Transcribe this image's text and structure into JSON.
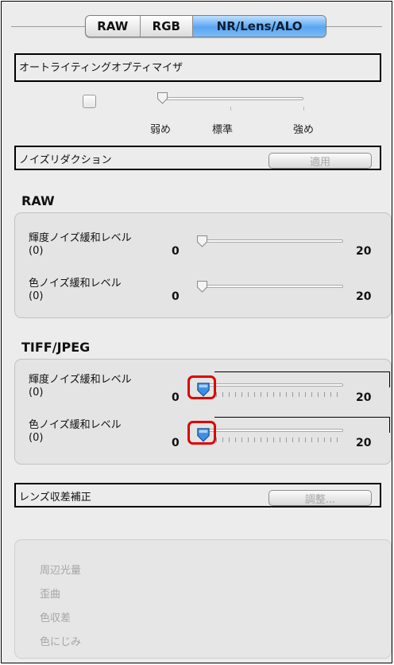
{
  "tabs": [
    {
      "label": "RAW",
      "active": false
    },
    {
      "label": "RGB",
      "active": false
    },
    {
      "label": "NR/Lens/ALO",
      "active": true
    }
  ],
  "alo": {
    "title": "オートライティングオプティマイザ",
    "checked": false,
    "scale": {
      "low": "弱め",
      "standard": "標準",
      "high": "強め"
    }
  },
  "noise_reduction": {
    "title": "ノイズリダクション",
    "apply_button": "適用",
    "raw": {
      "heading": "RAW",
      "luminance": {
        "label": "輝度ノイズ緩和レベル",
        "current": "(0)",
        "min": "0",
        "max": "20",
        "value": 0
      },
      "chroma": {
        "label": "色ノイズ緩和レベル",
        "current": "(0)",
        "min": "0",
        "max": "20",
        "value": 0
      }
    },
    "tiff": {
      "heading": "TIFF/JPEG",
      "luminance": {
        "label": "輝度ノイズ緩和レベル",
        "current": "(0)",
        "min": "0",
        "max": "20",
        "value": 0
      },
      "chroma": {
        "label": "色ノイズ緩和レベル",
        "current": "(0)",
        "min": "0",
        "max": "20",
        "value": 0
      }
    }
  },
  "lens": {
    "title": "レンズ収差補正",
    "adjust_button": "調整...",
    "items": [
      "周辺光量",
      "歪曲",
      "色収差",
      "色にじみ"
    ]
  },
  "colors": {
    "active_tab": "#5aa6f2",
    "highlight": "#e00000",
    "knob_blue": "#3d8fe6"
  }
}
